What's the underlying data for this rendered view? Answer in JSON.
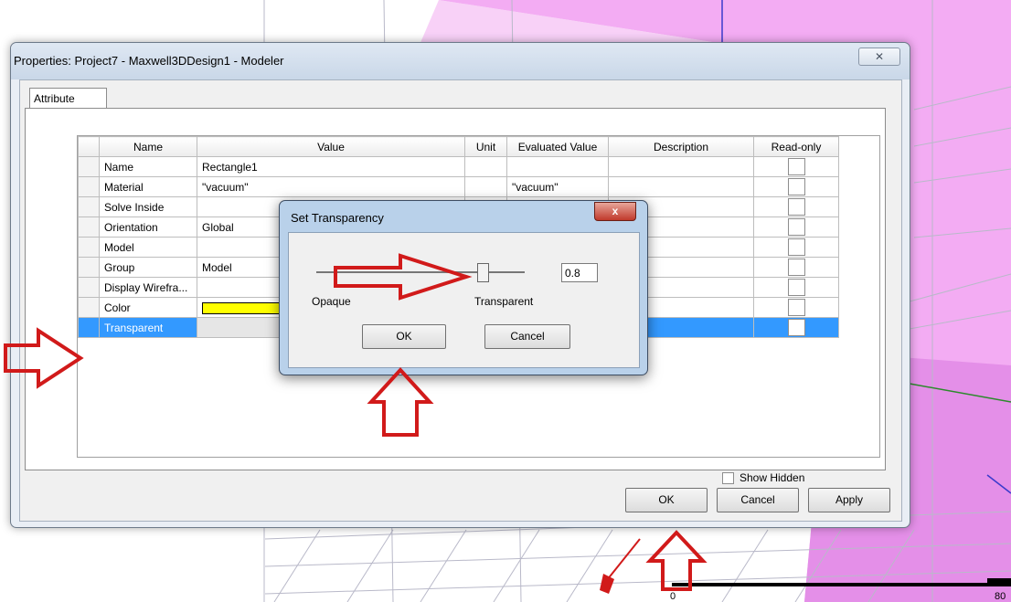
{
  "dialog": {
    "title": "Properties: Project7 - Maxwell3DDesign1 - Modeler",
    "close_glyph": "✕",
    "tab_label": "Attribute",
    "columns": [
      "Name",
      "Value",
      "Unit",
      "Evaluated Value",
      "Description",
      "Read-only"
    ],
    "rows": [
      {
        "name": "Name",
        "value": "Rectangle1",
        "unit": "",
        "evaluated": "",
        "description": "",
        "readonly": false
      },
      {
        "name": "Material",
        "value": "\"vacuum\"",
        "unit": "",
        "evaluated": "\"vacuum\"",
        "description": "",
        "readonly": false
      },
      {
        "name": "Solve Inside",
        "value": "",
        "unit": "",
        "evaluated": "",
        "description": "",
        "readonly": false
      },
      {
        "name": "Orientation",
        "value": "Global",
        "unit": "",
        "evaluated": "",
        "description": "",
        "readonly": false
      },
      {
        "name": "Model",
        "value": "",
        "unit": "",
        "evaluated": "",
        "description": "",
        "readonly": false
      },
      {
        "name": "Group",
        "value": "Model",
        "unit": "",
        "evaluated": "",
        "description": "",
        "readonly": false
      },
      {
        "name": "Display Wirefra...",
        "value": "",
        "unit": "",
        "evaluated": "",
        "description": "",
        "readonly": false
      },
      {
        "name": "Color",
        "value": "",
        "unit": "",
        "evaluated": "",
        "description": "",
        "readonly": false,
        "swatch": "#ffff00"
      },
      {
        "name": "Transparent",
        "value": "",
        "unit": "",
        "evaluated": "",
        "description": "",
        "readonly": false,
        "selected": true
      }
    ],
    "show_hidden_label": "Show Hidden",
    "ok_label": "OK",
    "cancel_label": "Cancel",
    "apply_label": "Apply"
  },
  "transparency": {
    "title": "Set Transparency",
    "close_glyph": "x",
    "value": "0.8",
    "level": 0.8,
    "opaque_label": "Opaque",
    "transparent_label": "Transparent",
    "ok_label": "OK",
    "cancel_label": "Cancel"
  },
  "viewport": {
    "scale_start": "0",
    "scale_end": "80"
  },
  "colors": {
    "selection": "#3399ff",
    "box_fill": "#f3a6f3",
    "annotation_arrow": "#d11a1a",
    "swatch": "#ffff00"
  }
}
